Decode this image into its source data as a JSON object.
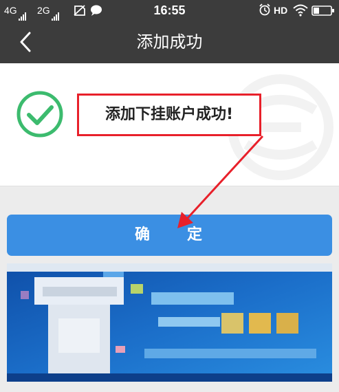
{
  "status_bar": {
    "network1": "4G",
    "network2": "2G",
    "time": "16:55",
    "hd": "HD"
  },
  "nav": {
    "title": "添加成功",
    "back_icon": "chevron-left-icon"
  },
  "success": {
    "message": "添加下挂账户成功!",
    "icon": "check-circle-icon",
    "icon_color": "#3cbb6e"
  },
  "confirm_button": {
    "char1": "确",
    "char2": "定",
    "color": "#3b8fe3"
  },
  "annotation": {
    "box_color": "#e8202a"
  },
  "banner": {
    "icon": "blurred-promo-banner",
    "primary_color": "#1b6ec9"
  }
}
